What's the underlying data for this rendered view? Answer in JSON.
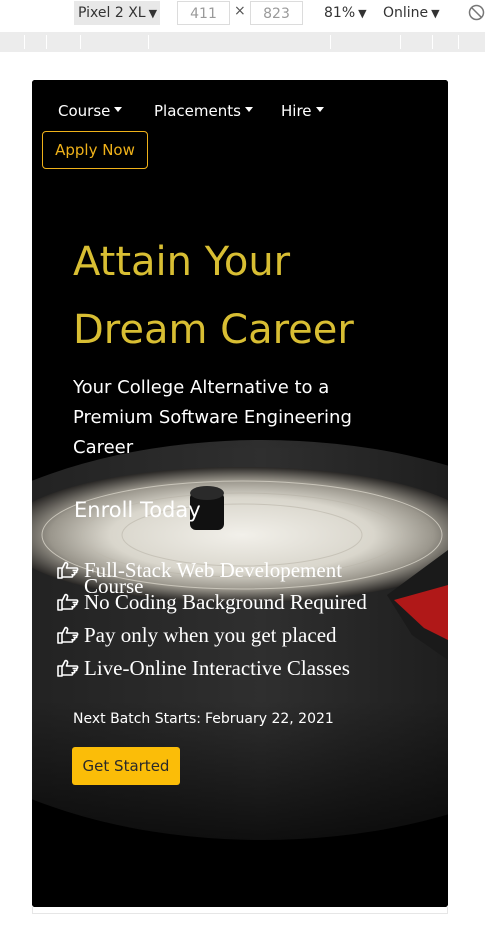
{
  "devtools": {
    "device": "Pixel 2 XL",
    "width": "411",
    "height": "823",
    "dimension_separator": "×",
    "zoom": "81%",
    "throttle": "Online",
    "icons": [
      "chevron-down-icon",
      "rotate-icon"
    ]
  },
  "nav": {
    "items": [
      {
        "label": "Course"
      },
      {
        "label": "Placements"
      },
      {
        "label": "Hire"
      }
    ],
    "apply_label": "Apply Now"
  },
  "hero": {
    "headline_line1": "Attain Your",
    "headline_line2": "Dream Career",
    "subheading": "Your College Alternative to a Premium Software Engineering Career",
    "enroll_label": "Enroll Today",
    "features": [
      "Full-Stack Web Developement Course",
      "No Coding Background Required",
      "Pay only when you get placed",
      "Live-Online Interactive Classes"
    ],
    "feature_icon": "hand-pointing-right-icon",
    "batch_prefix": "Next Batch Starts:",
    "batch_date": "February 22, 2021",
    "cta_label": "Get Started"
  },
  "colors": {
    "accent_yellow": "#d8be33",
    "button_yellow": "#fbbd08",
    "outline_orange": "#f0b21a",
    "background": "#000000",
    "text": "#ffffff"
  }
}
